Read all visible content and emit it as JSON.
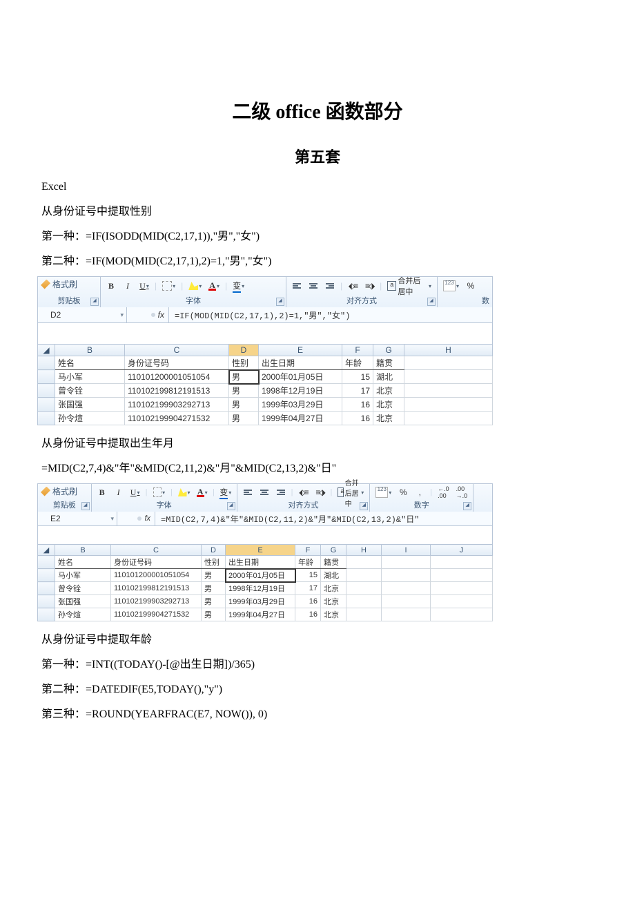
{
  "title": "二级 office 函数部分",
  "subtitle": "第五套",
  "intro_lines": {
    "l1": "Excel",
    "l2": "从身份证号中提取性别",
    "l3": "第一种：=IF(ISODD(MID(C2,17,1)),\"男\",\"女\")",
    "l4": "第二种：=IF(MOD(MID(C2,17,1),2)=1,\"男\",\"女\")"
  },
  "ribbon": {
    "format_painter": "格式刷",
    "clipboard": "剪贴板",
    "font": "字体",
    "alignment": "对齐方式",
    "number": "数字",
    "number_short": "数",
    "merge": "合并后居中",
    "bold": "B",
    "italic": "I",
    "underline": "U",
    "fontcolor": "A",
    "wen": "wén",
    "percent": "%",
    "comma": ",",
    "inc": ".0→.00",
    "dec": ".00→.0"
  },
  "shot1": {
    "cell_ref": "D2",
    "fx": "fx",
    "formula": "=IF(MOD(MID(C2,17,1),2)=1,\"男\",\"女\")",
    "cols": {
      "B": "B",
      "C": "C",
      "D": "D",
      "E": "E",
      "F": "F",
      "G": "G",
      "H": "H"
    },
    "headers": {
      "name": "姓名",
      "id": "身份证号码",
      "sex": "性别",
      "dob": "出生日期",
      "age": "年龄",
      "place": "籍贯"
    },
    "rows": [
      {
        "name": "马小军",
        "id": "110101200001051054",
        "sex": "男",
        "dob": "2000年01月05日",
        "age": "15",
        "place": "湖北"
      },
      {
        "name": "曾令铨",
        "id": "110102199812191513",
        "sex": "男",
        "dob": "1998年12月19日",
        "age": "17",
        "place": "北京"
      },
      {
        "name": "张国强",
        "id": "110102199903292713",
        "sex": "男",
        "dob": "1999年03月29日",
        "age": "16",
        "place": "北京"
      },
      {
        "name": "孙令煊",
        "id": "110102199904271532",
        "sex": "男",
        "dob": "1999年04月27日",
        "age": "16",
        "place": "北京"
      }
    ]
  },
  "mid_lines": {
    "l1": "从身份证号中提取出生年月",
    "l2": "=MID(C2,7,4)&\"年\"&MID(C2,11,2)&\"月\"&MID(C2,13,2)&\"日\""
  },
  "shot2": {
    "cell_ref": "E2",
    "fx": "fx",
    "formula": "=MID(C2,7,4)&\"年\"&MID(C2,11,2)&\"月\"&MID(C2,13,2)&\"日\"",
    "cols": {
      "B": "B",
      "C": "C",
      "D": "D",
      "E": "E",
      "F": "F",
      "G": "G",
      "H": "H",
      "I": "I",
      "J": "J"
    },
    "headers": {
      "name": "姓名",
      "id": "身份证号码",
      "sex": "性别",
      "dob": "出生日期",
      "age": "年龄",
      "place": "籍贯"
    },
    "rows": [
      {
        "name": "马小军",
        "id": "110101200001051054",
        "sex": "男",
        "dob": "2000年01月05日",
        "age": "15",
        "place": "湖北"
      },
      {
        "name": "曾令铨",
        "id": "110102199812191513",
        "sex": "男",
        "dob": "1998年12月19日",
        "age": "17",
        "place": "北京"
      },
      {
        "name": "张国强",
        "id": "110102199903292713",
        "sex": "男",
        "dob": "1999年03月29日",
        "age": "16",
        "place": "北京"
      },
      {
        "name": "孙令煊",
        "id": "110102199904271532",
        "sex": "男",
        "dob": "1999年04月27日",
        "age": "16",
        "place": "北京"
      }
    ]
  },
  "tail_lines": {
    "l1": "从身份证号中提取年龄",
    "l2": "第一种：=INT((TODAY()-[@出生日期])/365)",
    "l3": "第二种：=DATEDIF(E5,TODAY(),\"y\")",
    "l4": "第三种：=ROUND(YEARFRAC(E7, NOW()), 0)"
  }
}
